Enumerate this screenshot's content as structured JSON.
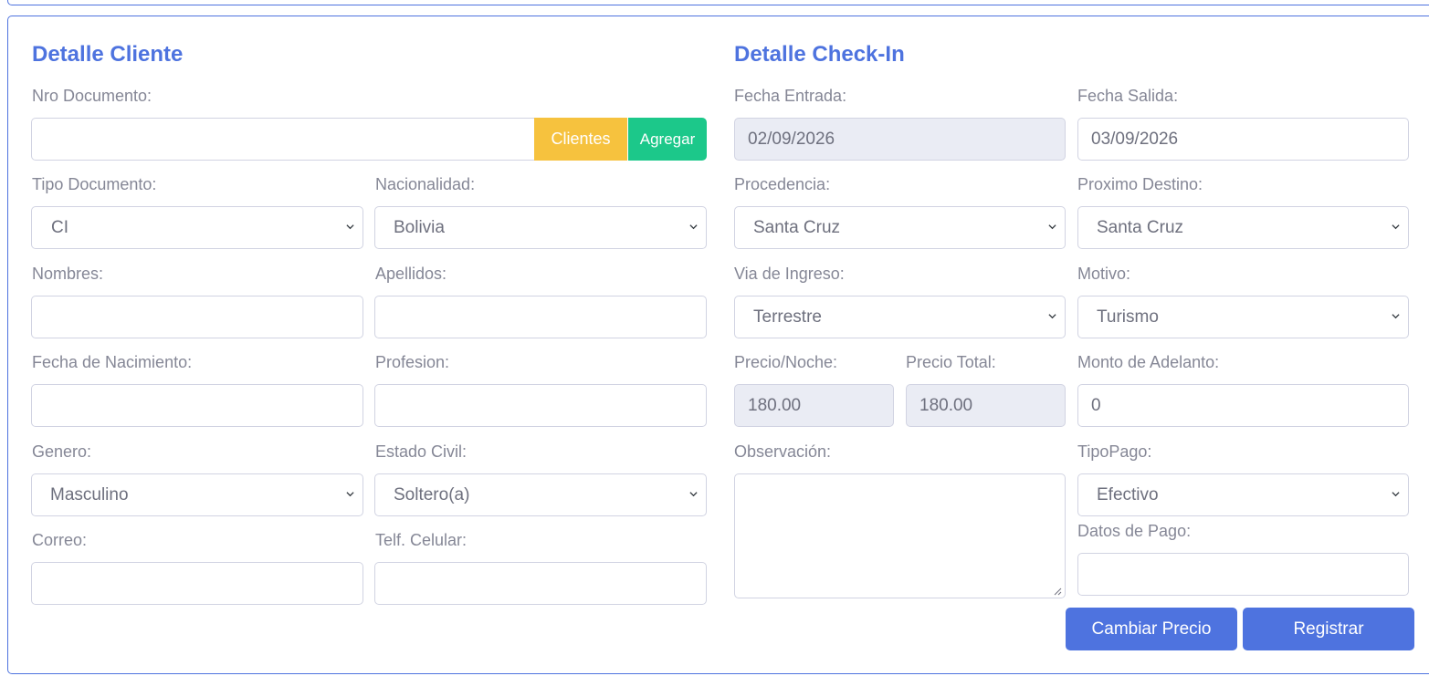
{
  "cliente": {
    "title": "Detalle Cliente",
    "nro_documento": {
      "label": "Nro Documento:",
      "value": ""
    },
    "clientes_button": "Clientes",
    "agregar_button": "Agregar",
    "tipo_documento": {
      "label": "Tipo Documento:",
      "selected": "CI"
    },
    "nacionalidad": {
      "label": "Nacionalidad:",
      "selected": "Bolivia"
    },
    "nombres": {
      "label": "Nombres:",
      "value": ""
    },
    "apellidos": {
      "label": "Apellidos:",
      "value": ""
    },
    "fecha_nacimiento": {
      "label": "Fecha de Nacimiento:",
      "value": ""
    },
    "profesion": {
      "label": "Profesion:",
      "value": ""
    },
    "genero": {
      "label": "Genero:",
      "selected": "Masculino"
    },
    "estado_civil": {
      "label": "Estado Civil:",
      "selected": "Soltero(a)"
    },
    "correo": {
      "label": "Correo:",
      "value": ""
    },
    "telf_celular": {
      "label": "Telf. Celular:",
      "value": ""
    }
  },
  "checkin": {
    "title": "Detalle Check-In",
    "fecha_entrada": {
      "label": "Fecha Entrada:",
      "value": "02/09/2026"
    },
    "fecha_salida": {
      "label": "Fecha Salida:",
      "value": "03/09/2026"
    },
    "procedencia": {
      "label": "Procedencia:",
      "selected": "Santa Cruz"
    },
    "proximo_destino": {
      "label": "Proximo Destino:",
      "selected": "Santa Cruz"
    },
    "via_ingreso": {
      "label": "Via de Ingreso:",
      "selected": "Terrestre"
    },
    "motivo": {
      "label": "Motivo:",
      "selected": "Turismo"
    },
    "precio_noche": {
      "label": "Precio/Noche:",
      "value": "180.00"
    },
    "precio_total": {
      "label": "Precio Total:",
      "value": "180.00"
    },
    "monto_adelanto": {
      "label": "Monto de Adelanto:",
      "value": "0"
    },
    "observacion": {
      "label": "Observación:",
      "value": ""
    },
    "tipo_pago": {
      "label": "TipoPago:",
      "selected": "Efectivo"
    },
    "datos_pago": {
      "label": "Datos de Pago:",
      "value": ""
    },
    "cambiar_precio_button": "Cambiar Precio",
    "registrar_button": "Registrar"
  },
  "colors": {
    "primary": "#4e73df",
    "warning": "#f6c23e",
    "success": "#1cc88a",
    "readonly_bg": "#eaecf4",
    "border": "#d1d3e2",
    "label_text": "#858796"
  },
  "icons": {
    "select_arrow": "chevron-down-icon",
    "textarea_resize": "resize-grip-icon"
  }
}
